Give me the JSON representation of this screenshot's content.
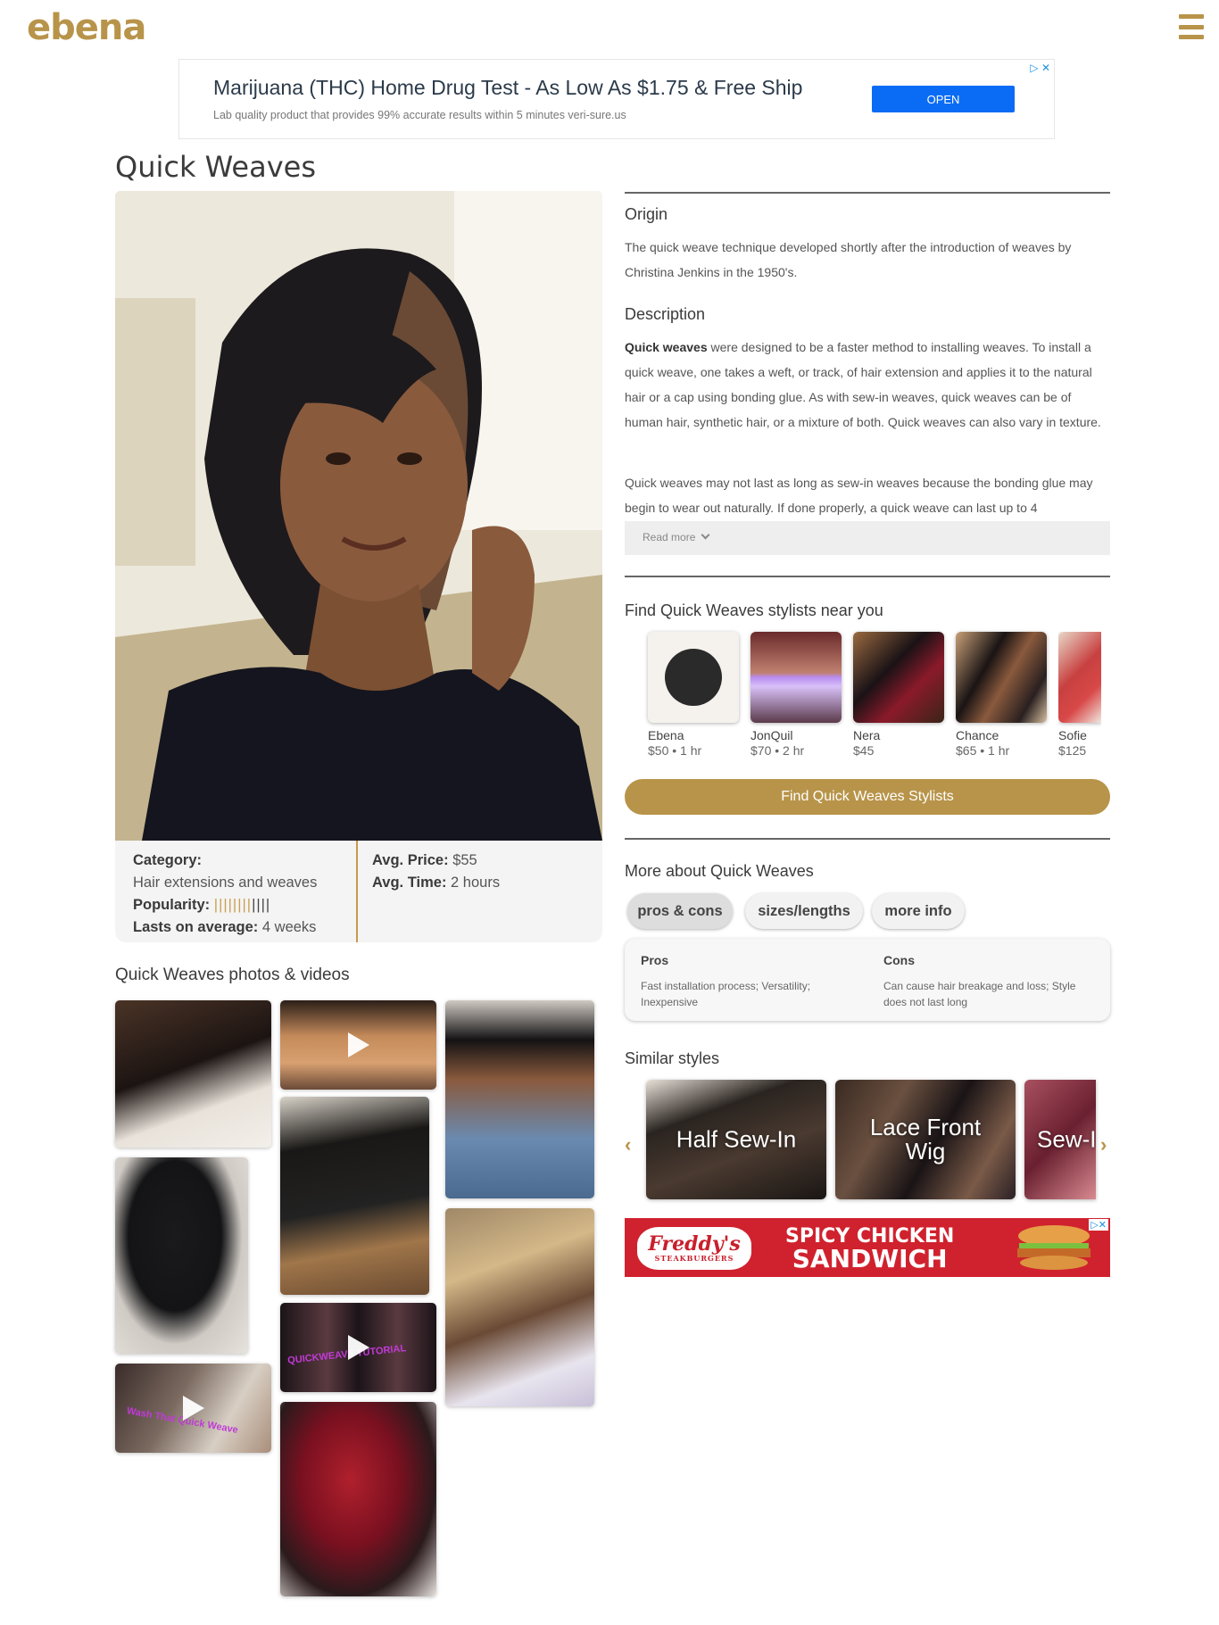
{
  "header": {
    "logo": "ebena",
    "menu_icon": "hamburger-menu-icon"
  },
  "ad_top": {
    "title": "Marijuana (THC) Home Drug Test - As Low As $1.75 & Free Ship",
    "subtitle": "Lab quality product that provides 99% accurate results within 5 minutes veri-sure.us",
    "button": "OPEN",
    "marks": "▷ ✕"
  },
  "page": {
    "title": "Quick Weaves"
  },
  "info": {
    "category_label": "Category:",
    "category_value": "Hair extensions and weaves",
    "popularity_label": "Popularity:",
    "popularity_gold": "||||||||",
    "popularity_dim": "||||",
    "lasts_label": "Lasts on average:",
    "lasts_value": "4 weeks",
    "price_label": "Avg. Price:",
    "price_value": "$55",
    "time_label": "Avg. Time:",
    "time_value": "2 hours"
  },
  "photos": {
    "title": "Quick Weaves photos & videos",
    "video_text_1": "QUICKWEAVE TUTORIAL",
    "video_text_2": "Wash That Quick Weave"
  },
  "origin": {
    "heading": "Origin",
    "text": "The quick weave technique developed shortly after the introduction of weaves by Christina Jenkins in the 1950's."
  },
  "description": {
    "heading": "Description",
    "bold_lead": "Quick weaves",
    "para1_rest": " were designed to be a faster method to installing weaves. To install a quick weave, one takes a weft, or track, of hair extension and applies it to the natural hair or a cap using bonding glue. As with sew-in weaves, quick weaves can be of human hair, synthetic hair, or a mixture of both. Quick weaves can also vary in texture.",
    "para2": "Quick weaves may not last as long as sew-in weaves because the bonding glue may begin to wear out naturally. If done properly, a quick weave can last up to 4",
    "read_more": "Read more"
  },
  "stylists": {
    "heading": "Find Quick Weaves stylists near you",
    "items": [
      {
        "name": "Ebena",
        "meta": "$50 • 1 hr"
      },
      {
        "name": "JonQuil",
        "meta": "$70 • 2 hr"
      },
      {
        "name": "Nera",
        "meta": "$45"
      },
      {
        "name": "Chance",
        "meta": "$65 • 1 hr"
      },
      {
        "name": "Sofie",
        "meta": "$125"
      }
    ],
    "button": "Find Quick Weaves Stylists"
  },
  "more_about": {
    "heading": "More about Quick Weaves",
    "tabs": [
      "pros & cons",
      "sizes/lengths",
      "more info"
    ],
    "pros_label": "Pros",
    "pros_text": "Fast installation process; Versatility; Inexpensive",
    "cons_label": "Cons",
    "cons_text": "Can cause hair breakage and loss; Style does not last long"
  },
  "similar": {
    "heading": "Similar styles",
    "items": [
      "Half Sew-In",
      "Lace Front Wig",
      "Sew-I"
    ]
  },
  "ad_bottom": {
    "brand": "Freddy's",
    "brand_sub": "STEAKBURGERS",
    "headline_1": "SPICY CHICKEN",
    "headline_2": "SANDWICH",
    "marks": "▷✕"
  },
  "colors": {
    "accent": "#b8944a",
    "ad_button": "#0a6cf5",
    "ad_bottom_bg": "#d0222e"
  }
}
